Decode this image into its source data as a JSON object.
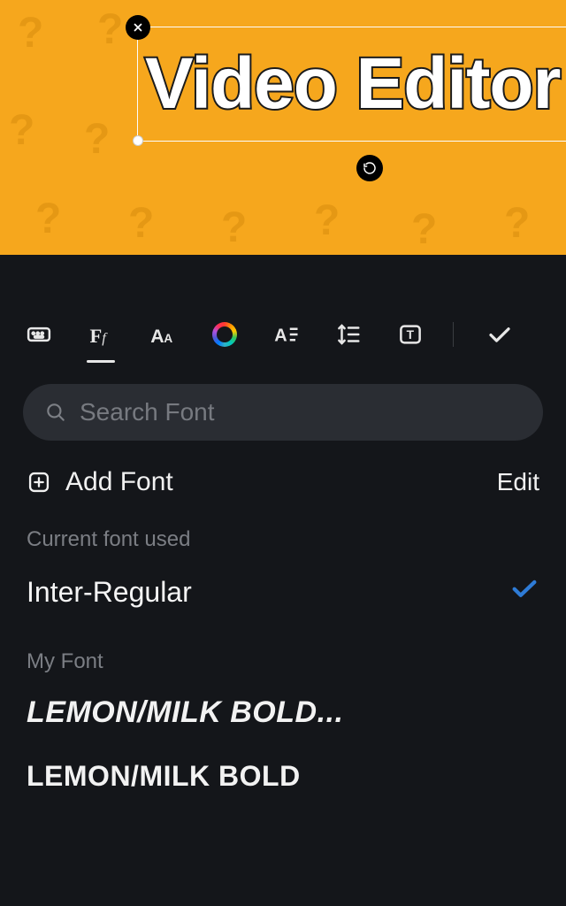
{
  "canvas": {
    "text": "Video Editor",
    "background": "#f6a71d"
  },
  "toolbar": {
    "tabs": [
      "keyboard",
      "font",
      "size",
      "color",
      "spacing",
      "lineheight",
      "box"
    ],
    "active_index": 1
  },
  "search": {
    "placeholder": "Search Font"
  },
  "actions": {
    "add_font": "Add Font",
    "edit": "Edit"
  },
  "sections": {
    "current_label": "Current font used",
    "myfont_label": "My Font"
  },
  "fonts": {
    "current": "Inter-Regular",
    "my": [
      "LEMON/MILK BOLD...",
      "LEMON/MILK BOLD"
    ]
  }
}
